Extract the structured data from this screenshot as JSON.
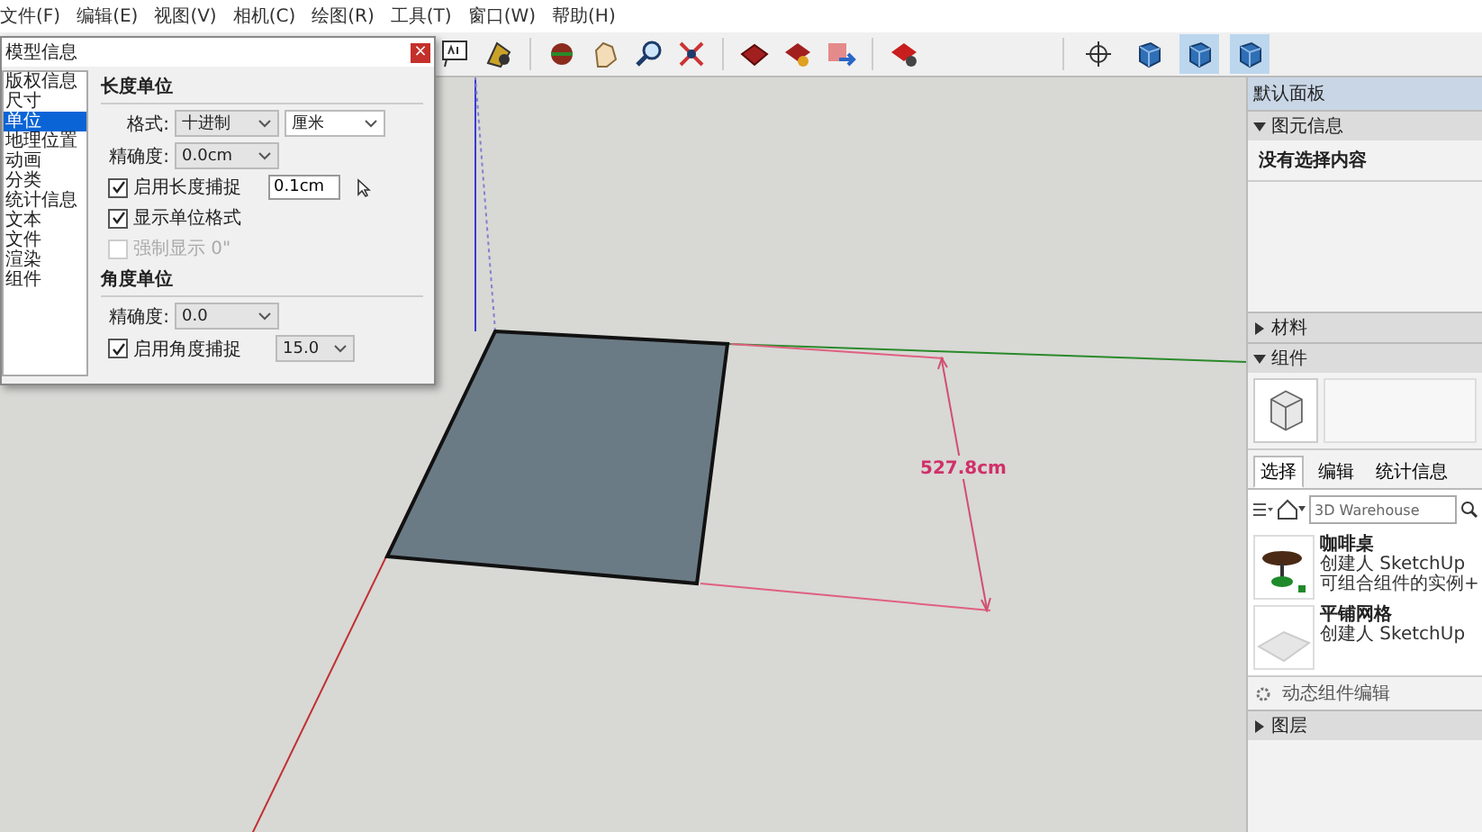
{
  "menu": [
    "文件(F)",
    "编辑(E)",
    "视图(V)",
    "相机(C)",
    "绘图(R)",
    "工具(T)",
    "窗口(W)",
    "帮助(H)"
  ],
  "view_buttons": [
    {
      "selected": false
    },
    {
      "selected": false
    },
    {
      "selected": true
    },
    {
      "selected": true
    }
  ],
  "dialog": {
    "title": "模型信息",
    "close": "×",
    "sections": [
      {
        "label": "版权信息",
        "selected": false
      },
      {
        "label": "尺寸",
        "selected": false
      },
      {
        "label": "单位",
        "selected": true
      },
      {
        "label": "地理位置",
        "selected": false
      },
      {
        "label": "动画",
        "selected": false
      },
      {
        "label": "分类",
        "selected": false
      },
      {
        "label": "统计信息",
        "selected": false
      },
      {
        "label": "文本",
        "selected": false
      },
      {
        "label": "文件",
        "selected": false
      },
      {
        "label": "渲染",
        "selected": false
      },
      {
        "label": "组件",
        "selected": false
      }
    ],
    "rows": [
      {
        "kind": "heading",
        "label": "长度单位"
      },
      {
        "kind": "select2",
        "label": "格式:",
        "values": [
          "十进制",
          "厘米"
        ]
      },
      {
        "kind": "select",
        "label": "精确度:",
        "value": "0.0cm"
      },
      {
        "kind": "check",
        "label": "启用长度捕捉",
        "checked": true,
        "disabled": false,
        "field": "0.1cm"
      },
      {
        "kind": "check",
        "label": "显示单位格式",
        "checked": true,
        "disabled": false
      },
      {
        "kind": "check",
        "label": "强制显示 0\"",
        "checked": false,
        "disabled": true
      },
      {
        "kind": "heading",
        "label": "角度单位"
      },
      {
        "kind": "select",
        "label": "精确度:",
        "value": "0.0"
      },
      {
        "kind": "check",
        "label": "启用角度捕捉",
        "checked": true,
        "disabled": false,
        "select": "15.0"
      }
    ]
  },
  "viewport": {
    "dimension": "527.8cm"
  },
  "panel": {
    "title": "默认面板",
    "entity_info": {
      "title": "图元信息",
      "expanded": true,
      "text": "没有选择内容"
    },
    "materials": {
      "title": "材料",
      "expanded": false
    },
    "components": {
      "title": "组件",
      "expanded": true,
      "tabs": [
        {
          "label": "选择",
          "selected": true
        },
        {
          "label": "编辑",
          "selected": false
        },
        {
          "label": "统计信息",
          "selected": false
        }
      ],
      "search": {
        "value": "3D Warehouse"
      },
      "items": [
        {
          "kind": "table",
          "name": "咖啡桌",
          "lines": [
            "创建人 SketchUp",
            "可组合组件的实例+"
          ]
        },
        {
          "kind": "grid",
          "name": "平铺网格",
          "lines": [
            "创建人 SketchUp"
          ]
        }
      ],
      "footer": "动态组件编辑"
    },
    "layers": {
      "title": "图层",
      "expanded": false
    }
  }
}
